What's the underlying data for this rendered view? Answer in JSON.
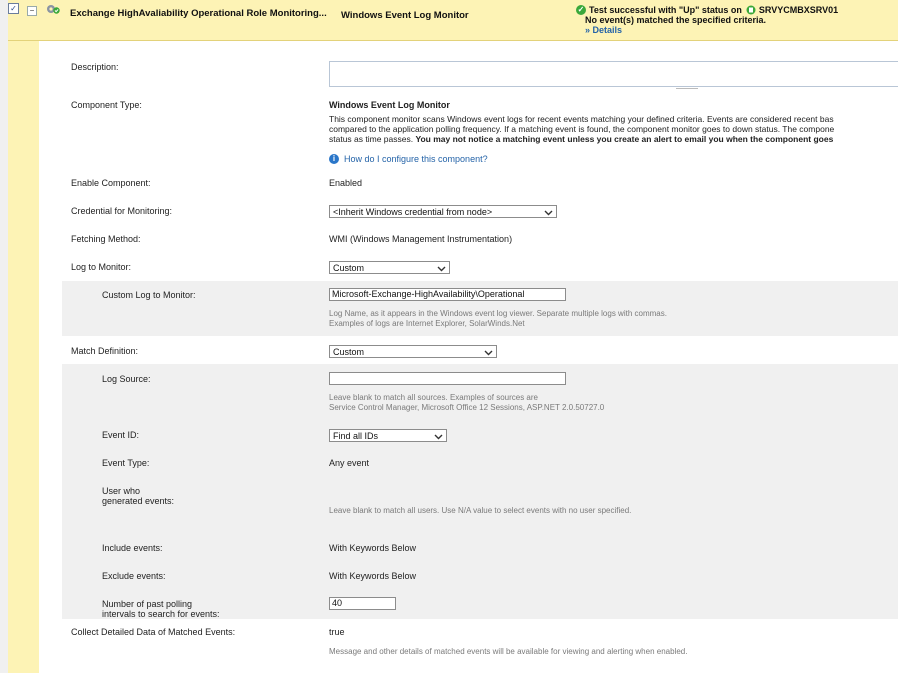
{
  "header": {
    "component_title": "Exchange HighAvaliability Operational Role Monitoring...",
    "monitor_name": "Windows Event Log Monitor",
    "test_status_prefix": "Test successful with \"Up\" status on",
    "test_server": "SRVYCMBXSRV01",
    "test_message": "No event(s) matched the specified criteria.",
    "details_link": "» Details"
  },
  "form": {
    "description_label": "Description:",
    "description_value": "",
    "component_type_label": "Component Type:",
    "component_type_value": "Windows Event Log Monitor",
    "component_type_desc_line1": "This component monitor scans Windows event logs for recent events matching your defined criteria. Events are considered recent bas",
    "component_type_desc_line2": "compared to the application polling frequency. If a matching event is found, the component monitor goes to down status. The compone",
    "component_type_desc_line3a": "status as time passes. ",
    "component_type_desc_line3b": "You may not notice a matching event unless you create an alert to email you when the component goes",
    "help_link": "How do I configure this component?",
    "enable_label": "Enable Component:",
    "enable_value": "Enabled",
    "credential_label": "Credential for Monitoring:",
    "credential_value": "<Inherit Windows credential from node>",
    "fetching_label": "Fetching Method:",
    "fetching_value": "WMI (Windows Management Instrumentation)",
    "log_label": "Log to Monitor:",
    "log_value": "Custom",
    "custom_log_label": "Custom Log to Monitor:",
    "custom_log_value": "Microsoft-Exchange-HighAvailability\\Operational",
    "custom_log_hint1": "Log Name, as it appears in the Windows event log viewer. Separate multiple logs with commas.",
    "custom_log_hint2": "Examples of logs are Internet Explorer, SolarWinds.Net",
    "match_label": "Match Definition:",
    "match_value": "Custom",
    "log_source_label": "Log Source:",
    "log_source_value": "",
    "log_source_hint1": "Leave blank to match all sources. Examples of sources are",
    "log_source_hint2": "Service Control Manager, Microsoft Office 12 Sessions, ASP.NET 2.0.50727.0",
    "event_id_label": "Event ID:",
    "event_id_value": "Find all IDs",
    "event_type_label": "Event Type:",
    "event_type_value": "Any event",
    "user_label_line1": "User who",
    "user_label_line2": "generated events:",
    "user_hint": "Leave blank to match all users. Use N/A value to select events with no user specified.",
    "include_label": "Include events:",
    "include_value": "With Keywords Below",
    "exclude_label": "Exclude events:",
    "exclude_value": "With Keywords Below",
    "polling_label_line1": "Number of past polling",
    "polling_label_line2": "intervals to search for events:",
    "polling_value": "40",
    "collect_label": "Collect Detailed Data of Matched Events:",
    "collect_value": "true",
    "collect_hint": "Message and other details of matched events will be available for viewing and alerting when enabled."
  },
  "icons": {
    "checkbox": "check-icon",
    "collapse": "minus-icon",
    "component": "gear-status-icon",
    "success": "check-circle-icon",
    "server": "server-status-icon",
    "info": "info-icon",
    "dropdown": "chevron-down-icon"
  },
  "colors": {
    "header_bg": "#fdf3b5",
    "link": "#2463a8",
    "ok": "#3aa83a"
  }
}
